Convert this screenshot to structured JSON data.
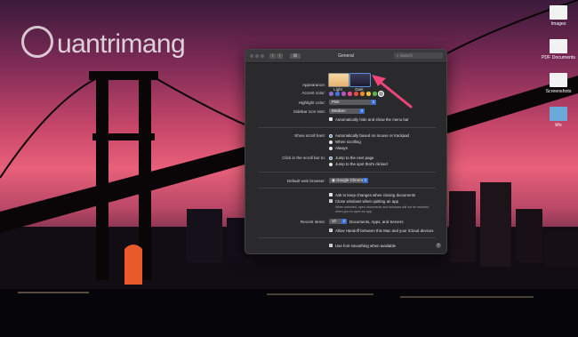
{
  "watermark": {
    "text": "uantrimang"
  },
  "desktop_icons": [
    {
      "label": "Images",
      "kind": "file"
    },
    {
      "label": "PDF Documents",
      "kind": "file"
    },
    {
      "label": "Screenshots",
      "kind": "file"
    },
    {
      "label": "bfo",
      "kind": "folder"
    }
  ],
  "window": {
    "title": "General",
    "search_placeholder": "Search"
  },
  "appearance": {
    "label": "Appearance:",
    "options": [
      {
        "label": "Light",
        "selected": false
      },
      {
        "label": "Dark",
        "selected": true
      }
    ]
  },
  "accent_color": {
    "label": "Accent color:",
    "swatches": [
      "#8e6ac6",
      "#3a7be0",
      "#b455c4",
      "#e84c8a",
      "#e84a45",
      "#f08a2c",
      "#f2c33a",
      "#5fb648",
      "#9a9a9a"
    ],
    "selected_index": 8
  },
  "highlight_color": {
    "label": "Highlight color:",
    "value": "Pink"
  },
  "sidebar_icon_size": {
    "label": "Sidebar icon size:",
    "value": "Medium"
  },
  "auto_hide_menu": {
    "label": "Automatically hide and show the menu bar",
    "checked": false
  },
  "show_scroll_bars": {
    "label": "Show scroll bars:",
    "options": [
      {
        "label": "Automatically based on mouse or trackpad",
        "selected": true
      },
      {
        "label": "When scrolling",
        "selected": false
      },
      {
        "label": "Always",
        "selected": false
      }
    ]
  },
  "click_scroll_bar": {
    "label": "Click in the scroll bar to:",
    "options": [
      {
        "label": "Jump to the next page",
        "selected": true
      },
      {
        "label": "Jump to the spot that's clicked",
        "selected": false
      }
    ]
  },
  "default_browser": {
    "label": "Default web browser:",
    "value": "Google Chrome"
  },
  "ask_keep_changes": {
    "label": "Ask to keep changes when closing documents",
    "checked": false
  },
  "close_windows": {
    "label": "Close windows when quitting an app",
    "checked": true,
    "note_line1": "When selected, open documents and windows will not be restored",
    "note_line2": "when you re-open an app."
  },
  "recent_items": {
    "label": "Recent items:",
    "value": "10",
    "suffix": "Documents, Apps, and Servers"
  },
  "allow_handoff": {
    "label": "Allow Handoff between this Mac and your iCloud devices",
    "checked": true
  },
  "font_smoothing": {
    "label": "Use font smoothing when available",
    "checked": true
  },
  "help_glyph": "?",
  "colors": {
    "accent_pink": "#f0457a",
    "selection_blue": "#3a6fd0",
    "window_bg": "#2a2a2c"
  }
}
